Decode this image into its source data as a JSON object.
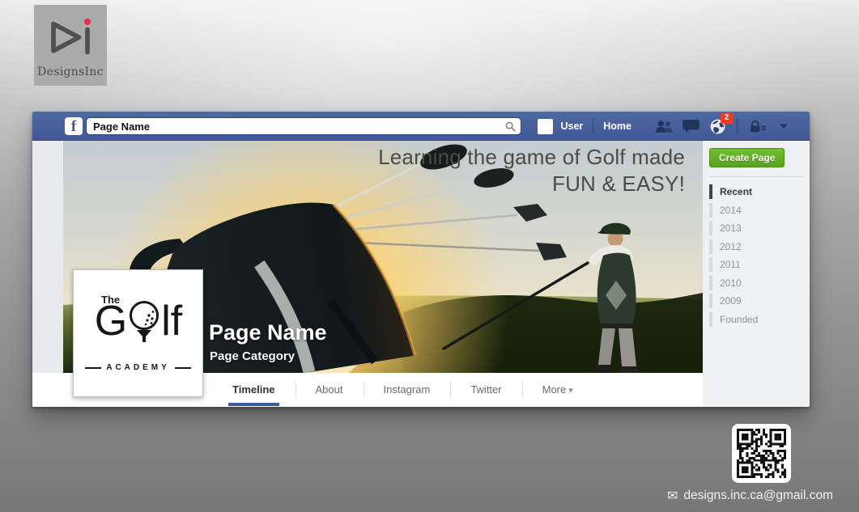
{
  "brand": {
    "name": "DesignsInc"
  },
  "facebook": {
    "header": {
      "logo_letter": "f",
      "search_value": "Page Name",
      "user_label": "User",
      "home_label": "Home",
      "notification_count": "2"
    },
    "cover": {
      "headline_line1": "Learning the game of Golf made",
      "headline_line2": "FUN & EASY!",
      "page_name": "Page Name",
      "page_category": "Page Category"
    },
    "profile_logo": {
      "line1": "The",
      "word_g": "G",
      "word_lf": "lf",
      "line3": "ACADEMY"
    },
    "tabs": [
      {
        "label": "Timeline",
        "active": true
      },
      {
        "label": "About",
        "active": false
      },
      {
        "label": "Instagram",
        "active": false
      },
      {
        "label": "Twitter",
        "active": false
      },
      {
        "label": "More",
        "active": false,
        "has_caret": true
      }
    ],
    "sidebar": {
      "create_button": "Create Page",
      "items": [
        {
          "label": "Recent",
          "active": true
        },
        {
          "label": "2014",
          "active": false
        },
        {
          "label": "2013",
          "active": false
        },
        {
          "label": "2012",
          "active": false
        },
        {
          "label": "2011",
          "active": false
        },
        {
          "label": "2010",
          "active": false
        },
        {
          "label": "2009",
          "active": false
        },
        {
          "label": "Founded",
          "active": false
        }
      ]
    }
  },
  "footer": {
    "email": "designs.inc.ca@gmail.com"
  },
  "icons": {
    "search": "magnifier",
    "friend_requests": "two-people",
    "messages": "chat-bubble",
    "notifications": "globe",
    "privacy": "lock-with-list",
    "account_menu": "caret-down",
    "email_glyph": "✉",
    "more_caret": "▾"
  },
  "colors": {
    "header_blue": "#4c66a4",
    "header_border": "#29487d",
    "badge_red": "#f03d25",
    "create_green": "#63b027",
    "tab_underline": "#3d5b9b",
    "canvas_gray": "#9a9a9a"
  }
}
